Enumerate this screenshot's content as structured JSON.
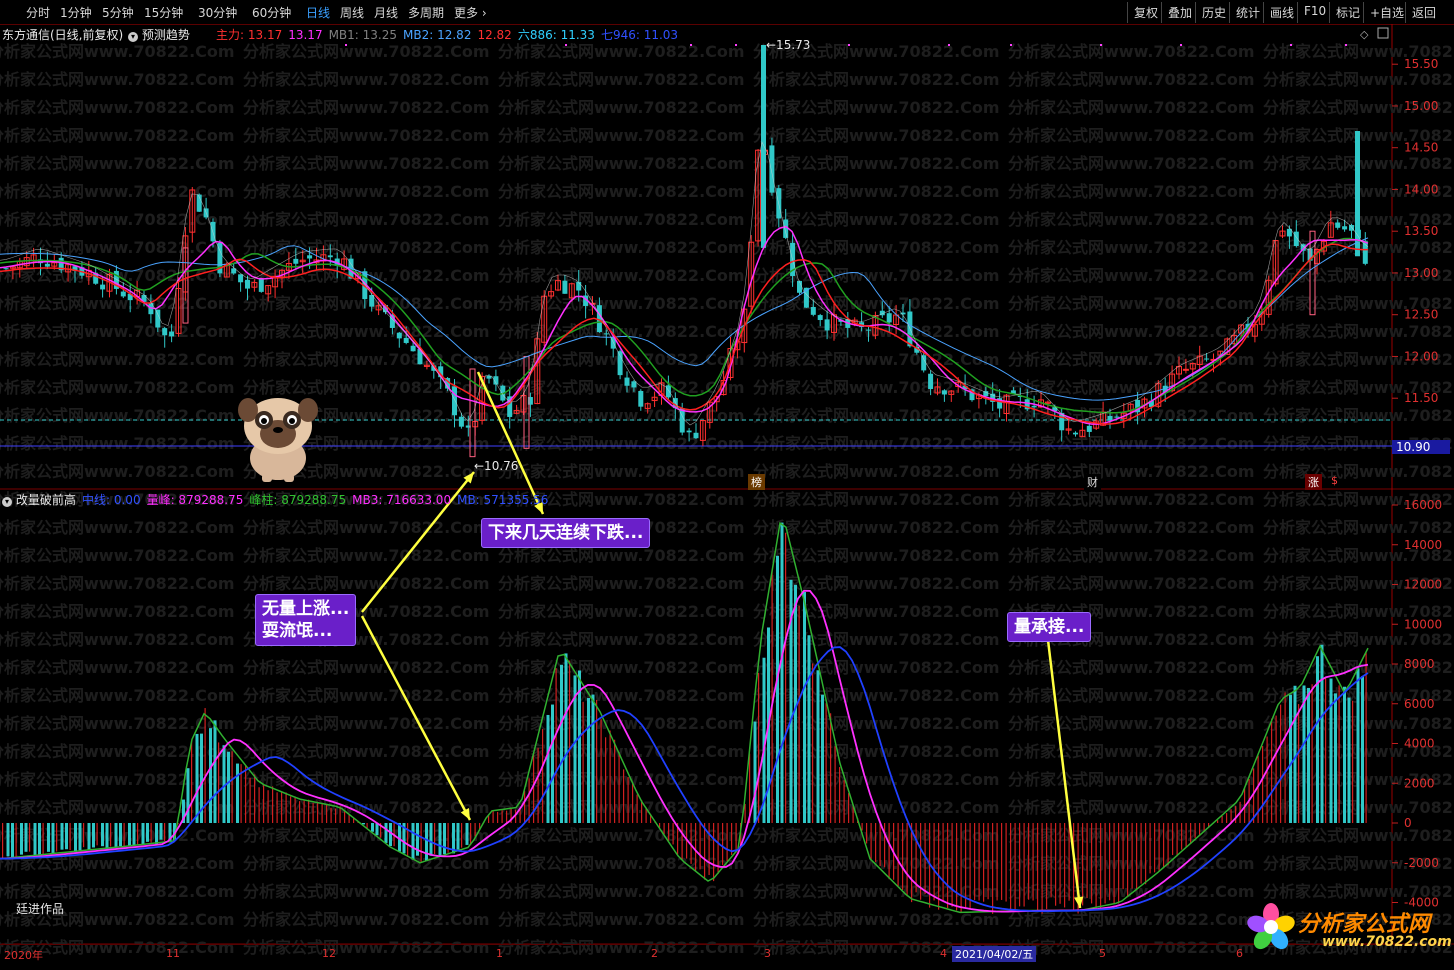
{
  "toolbar": {
    "periods": [
      "分时",
      "1分钟",
      "5分钟",
      "15分钟",
      "30分钟",
      "60分钟",
      "日线",
      "周线",
      "月线",
      "多周期",
      "更多"
    ],
    "active": "日线",
    "right_buttons": [
      "复权",
      "叠加",
      "历史",
      "统计",
      "画线",
      "F10",
      "标记",
      "+自选",
      "返回"
    ]
  },
  "main_panel": {
    "title": "东方通信(日线,前复权)",
    "indicator": "预测趋势",
    "legend": [
      {
        "label": "主力: 13.17",
        "color": "#ff3030"
      },
      {
        "label": "13.17",
        "color": "#ff30ff"
      },
      {
        "label": "MB1: 13.25",
        "color": "#808080"
      },
      {
        "label": "MB2: 12.82",
        "color": "#4aa3ff"
      },
      {
        "label": "12.82",
        "color": "#ff3030"
      },
      {
        "label": "六886: 11.33",
        "color": "#30d0ff"
      },
      {
        "label": "七946: 11.03",
        "color": "#3050ff"
      }
    ],
    "high_label": "15.73",
    "low_label": "10.76",
    "yticks": [
      "15.50",
      "15.00",
      "14.50",
      "14.00",
      "13.50",
      "13.00",
      "12.50",
      "12.00",
      "11.50"
    ],
    "price_tag": "10.90"
  },
  "sub_panel": {
    "title": "改量破前高",
    "legend": [
      {
        "label": "中线: 0.00",
        "color": "#3050ff"
      },
      {
        "label": "量峰: 879288.75",
        "color": "#ff30ff"
      },
      {
        "label": "峰柱: 879288.75",
        "color": "#30c030"
      },
      {
        "label": "MB3: 716633.00",
        "color": "#ff30ff"
      },
      {
        "label": "MB: 571355.56",
        "color": "#3050ff"
      }
    ],
    "yticks": [
      "16000",
      "14000",
      "12000",
      "10000",
      "8000",
      "6000",
      "4000",
      "2000",
      "0",
      "-2000",
      "-4000"
    ]
  },
  "annotations": {
    "note1_line1": "无量上涨...",
    "note1_line2": "耍流氓...",
    "note2": "下来几天连续下跌...",
    "note3": "量承接..."
  },
  "badges": [
    "榜",
    "财",
    "涨",
    "$"
  ],
  "author": "廷进作品",
  "dates": {
    "year": "2020年",
    "m11": "11",
    "m12": "12",
    "m1": "1",
    "m2": "2",
    "m3": "3",
    "m4": "4",
    "selected": "2021/04/02/五",
    "m5": "5",
    "m6": "6"
  },
  "watermark": "分析家公式网www.70822.Com",
  "logo": {
    "text": "分析家公式网",
    "url": "www.70822.com"
  },
  "chart_data": {
    "type": "candlestick",
    "ylim": [
      10.5,
      15.8
    ],
    "sub_ylim": [
      -4400,
      16500
    ],
    "up_color": "#ff3030",
    "down_color": "#30c8c8"
  }
}
